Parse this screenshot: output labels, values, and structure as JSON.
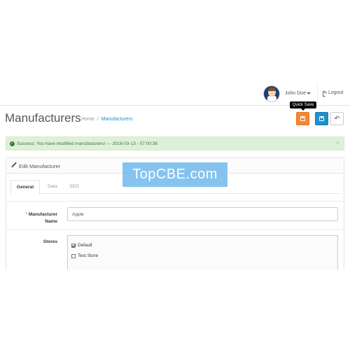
{
  "header": {
    "user_name": "John Doe",
    "logout_label": "Logout"
  },
  "page": {
    "title": "Manufacturers",
    "breadcrumb": [
      {
        "label": "Home"
      },
      {
        "label": "Manufacturers"
      }
    ]
  },
  "toolbar": {
    "tooltip": "Quick Save"
  },
  "alert": {
    "text": "Success: You have modified manufacturers! --- 2018-03-13 - 07:00:38",
    "close": "×"
  },
  "panel": {
    "title": "Edit Manufacturer"
  },
  "tabs": [
    {
      "label": "General",
      "active": true
    },
    {
      "label": "Data",
      "active": false
    },
    {
      "label": "SEO",
      "active": false
    }
  ],
  "form": {
    "name_required_mark": "*",
    "name_label": "Manufacturer Name",
    "name_value": "Apple",
    "stores_label": "Stores",
    "stores": [
      {
        "label": "Default",
        "checked": true
      },
      {
        "label": "Test Store",
        "checked": false
      }
    ]
  },
  "watermark": "TopCBE.com",
  "colors": {
    "primary": "#1e91cf",
    "quick_save": "#f38733",
    "success_bg": "#dff0d8",
    "success_text": "#3c763d"
  }
}
